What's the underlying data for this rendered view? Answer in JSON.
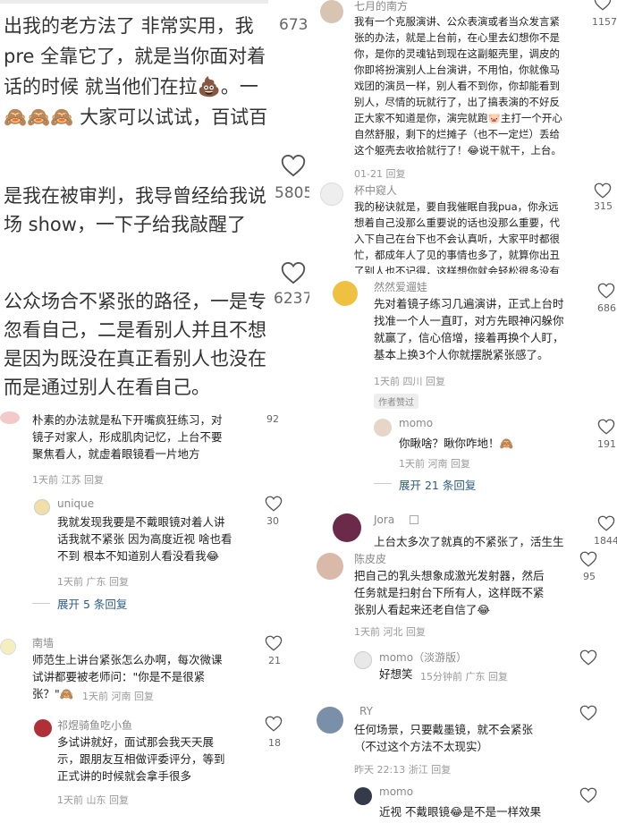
{
  "colors": {
    "link": "#2b5c8a",
    "meta": "#999999",
    "heart": "#555555"
  },
  "topleft": {
    "lines": [
      "出我的老方法了 非常实用，我",
      "pre 全靠它了，就是当你面对着",
      "话的时候 就当他们在拉💩。一",
      "🙈🙈🙈 大家可以试试，百试百"
    ],
    "count": "673"
  },
  "midleft1": {
    "lines": [
      "是我在被审判，我导曾经给我说",
      "场 show，一下子给我敲醒了"
    ],
    "count": "5805"
  },
  "midleft2": {
    "lines": [
      "公众场合不紧张的路径，一是专",
      "忽看自己，二是看别人并且不想",
      "是因为既没在真正看别人也没在",
      "而是通过别人在看自己。"
    ],
    "count": "6237"
  },
  "left_comments": {
    "c1": {
      "lines": [
        "朴素的办法就是私下开嘴疯狂练习，对",
        "镜子对家人，形成肌肉记忆，上台不要",
        "聚焦看人，就虚着眼镜看一片地方"
      ],
      "meta": "1天前 江苏 回复",
      "count": "92"
    },
    "c1r": {
      "name": "unique",
      "lines": [
        "我就发现我要是不戴眼镜对着人讲",
        "话我就不紧张 因为高度近视 啥也看",
        "不到 根本不知道别人看没看我😂"
      ],
      "meta": "1天前 广东 回复",
      "count": "30"
    },
    "c1x": "展开 5 条回复",
    "c2": {
      "name": "南墙",
      "lines": [
        "师范生上讲台紧张怎么办啊，每次微课",
        "试讲都要被老师问：\"你是不是很紧",
        "张？\"🙈"
      ],
      "meta_inline": "1天前 河南 回复",
      "count": "21"
    },
    "c2r": {
      "name": "祁煜骑鱼吃小鱼",
      "lines": [
        "多试讲就好，面试那会我天天展",
        "示，跟朋友互相做评委评分，等到",
        "正式讲的时候就会拿手很多"
      ],
      "meta": "1天前 山东 回复",
      "count": "18"
    }
  },
  "right_top": {
    "name": "七月的南方",
    "lines": [
      "我有一个克服演讲、公众表演或者当众发言紧",
      "张的办法，就是上台前，在心里去幻想你不是",
      "你，是你的灵魂钻到现在这副躯壳里，调皮的",
      "你即将扮演别人上台演讲，不用怕，你就像马",
      "戏团的演员一样，别人看不到你，你却能看到",
      "别人，尽情的玩就行了，出了搞表演的不好反",
      "正大家不知道是你，演完就跑🐷主打一个开心",
      "自然舒服，剩下的烂摊子（也不一定烂）丢给",
      "这个躯壳去收拾就行了！😂说干就干，上台。"
    ],
    "meta": "01-21 回复",
    "count": "1157"
  },
  "right_2": {
    "name": "杯中窥人",
    "lines": [
      "我的秘诀就是，要自我催眠自我pua，你永远",
      "想着自己没那么重要说的话也没那么重要，代",
      "入下自己在台下也不会认真听，大家平时都很",
      "忙，都成年人了见的事情也多了，就算你出丑",
      "了别人也不记得，这样想你就会轻松很多没有"
    ],
    "count": "315"
  },
  "right_3": {
    "name": "然然爱遛娃",
    "lines": [
      "先对着镜子练习几遍演讲，正式上台时",
      "找准一个人一直盯，对方先眼神闪躲你",
      "就赢了，信心倍增，接着再换个人盯，",
      "基本上换3个人你就摆脱紧张感了。"
    ],
    "meta": "1天前 四川 回复",
    "badge": "作者赞过",
    "count": "686"
  },
  "right_3r": {
    "name": "momo",
    "text": "你瞅啥？瞅你咋地！🙈",
    "meta": "1天前 河南 回复",
    "count": "191",
    "expand": "展开 21 条回复"
  },
  "right_4": {
    "name": "Jora",
    "text": "上台太多次了就真的不紧张了，活生生",
    "count": "1844"
  },
  "right_5": {
    "name": "陈皮皮",
    "lines": [
      "把自己的乳头想象成激光发射器，然后",
      "任务就是扫射台下所有人，这样既不紧",
      "张别人看起来还老自信了😂"
    ],
    "meta": "1天前 河北 回复",
    "count": "95",
    "reply": {
      "name": "momo（淡游版）",
      "text": "好想笑",
      "meta": "15分钟前 广东 回复"
    }
  },
  "right_6": {
    "name": "RY",
    "lines": [
      "任何场景，只要戴墨镜，就不会紧张",
      "（不过这个方法不太现实）"
    ],
    "meta": "昨天 22:13 浙江 回复",
    "reply": {
      "name": "momo",
      "text": "近视 不戴眼镜😂是不是一样效果"
    }
  }
}
